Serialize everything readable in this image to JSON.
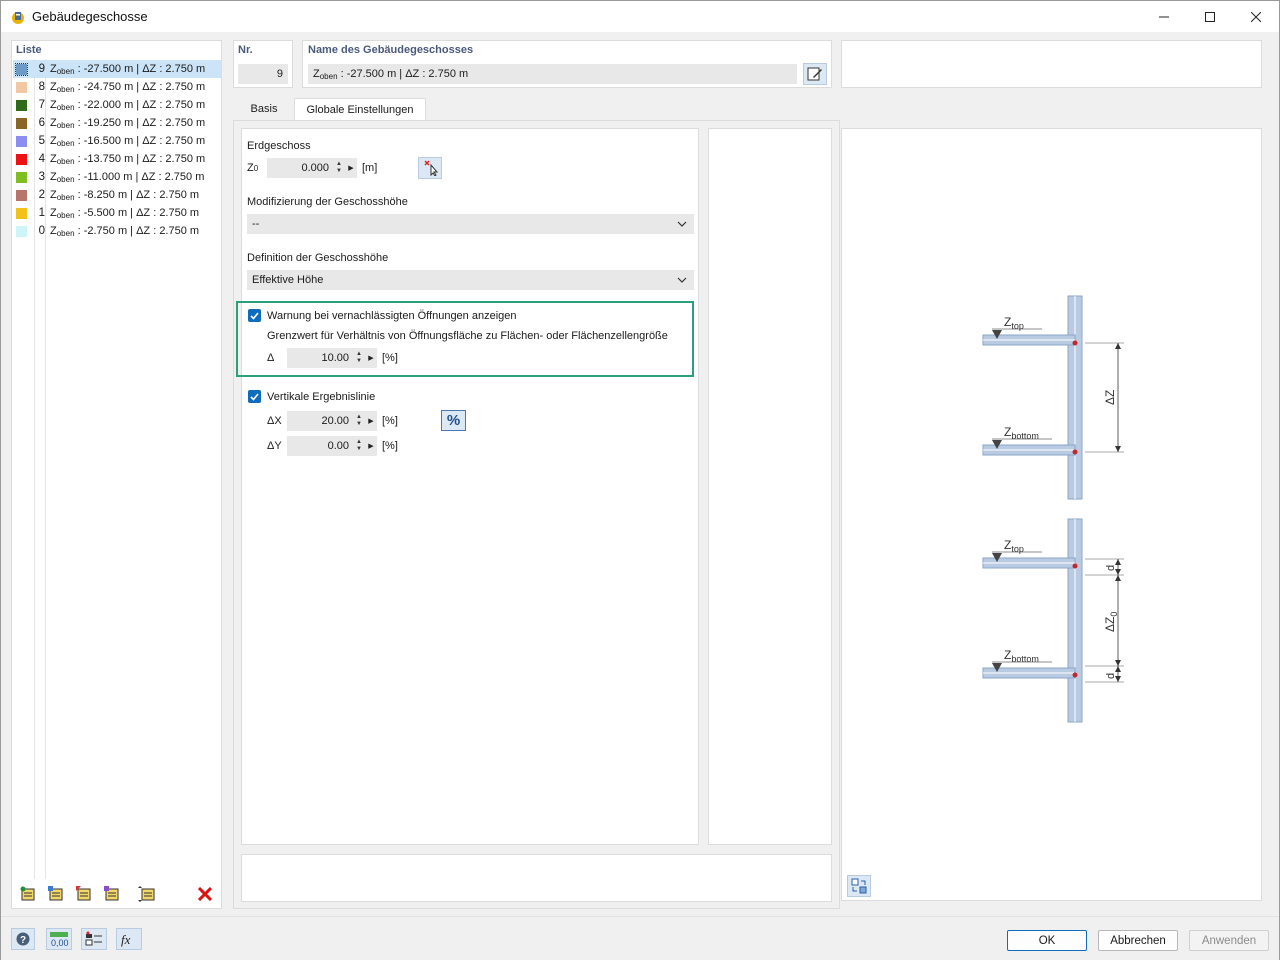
{
  "window": {
    "title": "Gebäudegeschosse"
  },
  "list": {
    "header": "Liste",
    "items": [
      {
        "num": "9",
        "z": "-27.500 m",
        "dz": "2.750 m",
        "color": "#6b9bc6",
        "selected": true
      },
      {
        "num": "8",
        "z": "-24.750 m",
        "dz": "2.750 m",
        "color": "#f2c7a3"
      },
      {
        "num": "7",
        "z": "-22.000 m",
        "dz": "2.750 m",
        "color": "#2e6b1a"
      },
      {
        "num": "6",
        "z": "-19.250 m",
        "dz": "2.750 m",
        "color": "#8a6526"
      },
      {
        "num": "5",
        "z": "-16.500 m",
        "dz": "2.750 m",
        "color": "#8a8ef2"
      },
      {
        "num": "4",
        "z": "-13.750 m",
        "dz": "2.750 m",
        "color": "#ee1111"
      },
      {
        "num": "3",
        "z": "-11.000 m",
        "dz": "2.750 m",
        "color": "#7fbf23"
      },
      {
        "num": "2",
        "z": "-8.250 m",
        "dz": "2.750 m",
        "color": "#b8736b"
      },
      {
        "num": "1",
        "z": "-5.500 m",
        "dz": "2.750 m",
        "color": "#f1c21a"
      },
      {
        "num": "0",
        "z": "-2.750 m",
        "dz": "2.750 m",
        "color": "#cdf5f8"
      }
    ],
    "z_prefix": "Z",
    "z_sub": "oben",
    "sep": " : ",
    "dz_label": " | ΔZ : "
  },
  "nr": {
    "label": "Nr.",
    "value": "9"
  },
  "name": {
    "label": "Name des Gebäudegeschosses",
    "value": "Zoben : -27.500 m | ΔZ : 2.750 m"
  },
  "tabs": [
    {
      "label": "Basis"
    },
    {
      "label": "Globale Einstellungen"
    }
  ],
  "settings": {
    "erdgeschoss_label": "Erdgeschoss",
    "z0_label": "Z0",
    "z0_value": "0.000",
    "z0_unit": "[m]",
    "mod_label": "Modifizierung der Geschosshöhe",
    "mod_value": "--",
    "def_label": "Definition der Geschosshöhe",
    "def_value": "Effektive Höhe",
    "warn_label": "Warnung bei vernachlässigten Öffnungen anzeigen",
    "warn_checked": true,
    "grenz_label": "Grenzwert für Verhältnis von Öffnungsfläche zu Flächen- oder Flächenzellengröße",
    "delta_label": "Δ",
    "delta_value": "10.00",
    "delta_unit": "[%]",
    "vert_label": "Vertikale Ergebnislinie",
    "vert_checked": true,
    "dx_label": "ΔX",
    "dx_value": "20.00",
    "dx_unit": "[%]",
    "dy_label": "ΔY",
    "dy_value": "0.00",
    "dy_unit": "[%]",
    "percent_btn": "%"
  },
  "diagram": {
    "z_top": "Z",
    "z_top_sub": "top",
    "z_bottom": "Z",
    "z_bottom_sub": "bottom",
    "dz": "ΔZ",
    "dz0": "ΔZ",
    "dz0_sub": "0",
    "d": "d"
  },
  "footer": {
    "ok": "OK",
    "cancel": "Abbrechen",
    "apply": "Anwenden",
    "units_value": "0,00"
  },
  "colors": {
    "accent": "#0f6cbd",
    "highlight_box": "#2aa17c"
  }
}
